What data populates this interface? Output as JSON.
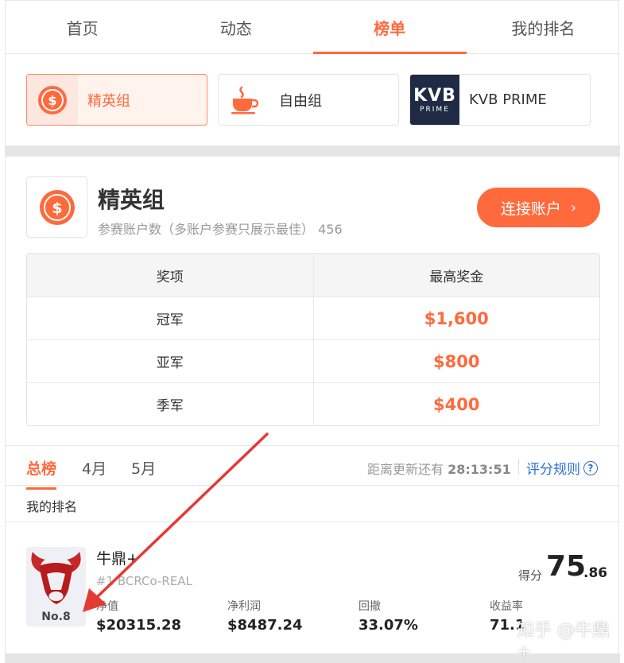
{
  "nav": {
    "tabs": [
      {
        "label": "首页"
      },
      {
        "label": "动态"
      },
      {
        "label": "榜单"
      },
      {
        "label": "我的排名"
      }
    ]
  },
  "groups": [
    {
      "label": "精英组",
      "icon": "dollar-coin-icon"
    },
    {
      "label": "自由组",
      "icon": "coffee-cup-icon"
    },
    {
      "label": "KVB PRIME",
      "icon": "kvb-prime-logo"
    }
  ],
  "elite": {
    "title": "精英组",
    "subtitle": "参赛账户数（多账户参赛只展示最佳）",
    "count": "456",
    "connect_label": "连接账户",
    "chevron": "›"
  },
  "prize_table": {
    "headers": [
      "奖项",
      "最高奖金"
    ],
    "rows": [
      {
        "place": "冠军",
        "amount": "$1,600"
      },
      {
        "place": "亚军",
        "amount": "$800"
      },
      {
        "place": "季军",
        "amount": "$400"
      }
    ]
  },
  "ranking": {
    "tabs": [
      {
        "label": "总榜"
      },
      {
        "label": "4月"
      },
      {
        "label": "5月"
      }
    ],
    "countdown_label": "距离更新还有",
    "countdown_value": "28:13:51",
    "rules_label": "评分规则",
    "my_rank_label": "我的排名"
  },
  "my_entry": {
    "rank_badge": "No.8",
    "name": "牛鼎+",
    "account": "#1  BCRCo-REAL",
    "score_label": "得分",
    "score_int": "75",
    "score_dec": ".86",
    "stats": [
      {
        "label": "净值",
        "value": "$20315.28"
      },
      {
        "label": "净利润",
        "value": "$8487.24"
      },
      {
        "label": "回撤",
        "value": "33.07%"
      },
      {
        "label": "收益率",
        "value": "71.1"
      }
    ]
  },
  "watermark": "知乎 @牛鼎+",
  "colors": {
    "accent": "#ff6a3d",
    "link": "#2a6fd6",
    "annotation_arrow": "#e53935"
  }
}
